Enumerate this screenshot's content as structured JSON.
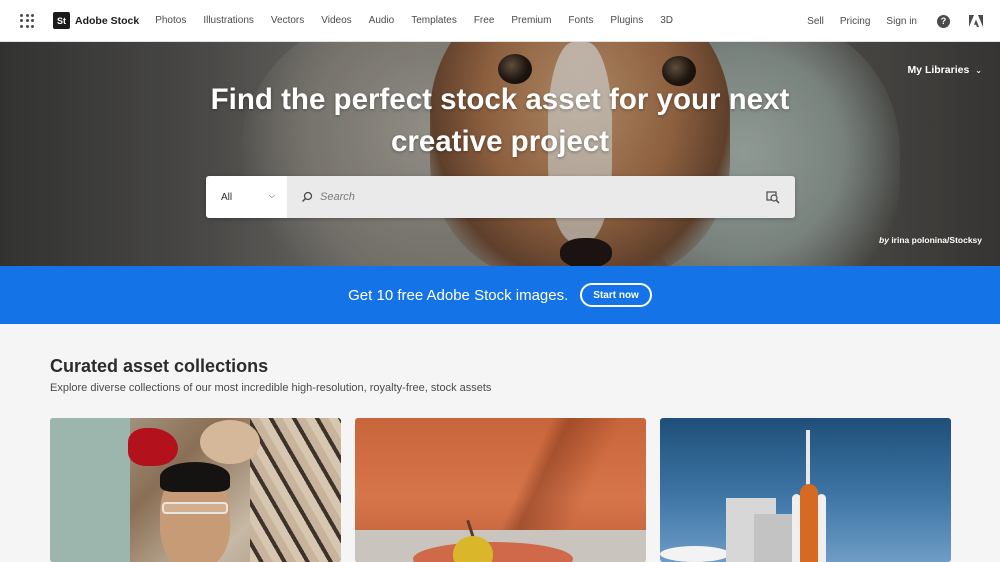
{
  "nav": {
    "brand": "Adobe Stock",
    "brand_badge": "St",
    "links": [
      "Photos",
      "Illustrations",
      "Vectors",
      "Videos",
      "Audio",
      "Templates",
      "Free",
      "Premium",
      "Fonts",
      "Plugins",
      "3D"
    ],
    "sell": "Sell",
    "pricing": "Pricing",
    "signin": "Sign in",
    "help_glyph": "?"
  },
  "hero": {
    "title_line1": "Find the perfect stock asset for your next",
    "title_line2": "creative project",
    "my_libraries": "My Libraries",
    "credit_prefix": "by",
    "credit_name": "irina polonina/Stocksy",
    "search": {
      "category": "All",
      "placeholder": "Search"
    }
  },
  "promo": {
    "text": "Get 10 free Adobe Stock images.",
    "button": "Start now",
    "color": "#1473e6"
  },
  "curated": {
    "title": "Curated asset collections",
    "subtitle": "Explore diverse collections of our most incredible high-resolution, royalty-free, stock assets"
  },
  "icons": {
    "apps": "app-grid-icon",
    "search": "magnifier-icon",
    "visual_search": "image-search-icon",
    "help": "help-icon",
    "adobe": "adobe-logo-icon"
  }
}
